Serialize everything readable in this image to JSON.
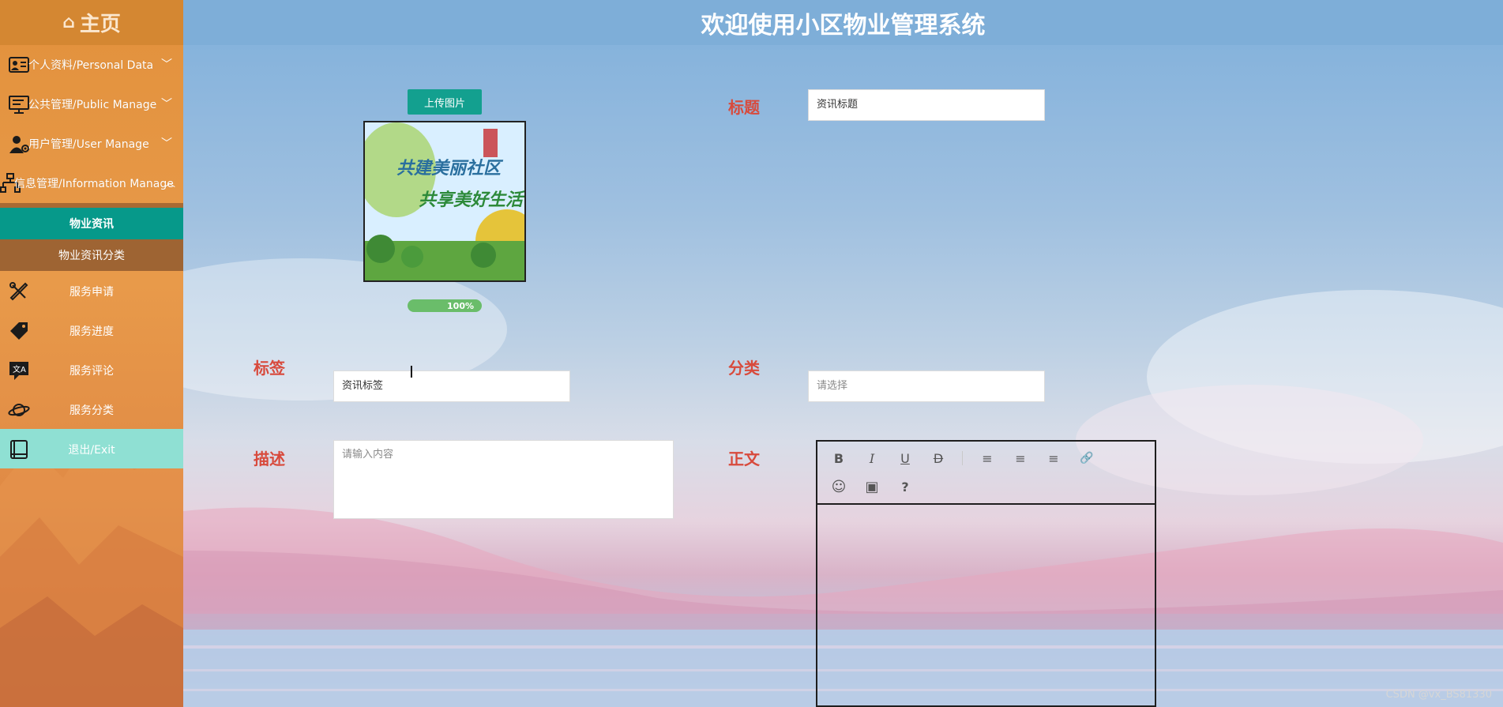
{
  "sidebar": {
    "home_label": "主页",
    "menus": [
      {
        "label": "个人资料/Personal Data",
        "icon": "user-card-icon",
        "chevron": "﹀"
      },
      {
        "label": "公共管理/Public Manage",
        "icon": "monitor-icon",
        "chevron": "﹀"
      },
      {
        "label": "用户管理/User Manage",
        "icon": "user-gear-icon",
        "chevron": "﹀"
      },
      {
        "label": "信息管理/Information Manage",
        "icon": "hierarchy-icon",
        "chevron": "︿"
      }
    ],
    "sub_items": [
      {
        "label": "物业资讯",
        "active": true
      },
      {
        "label": "物业资讯分类",
        "active": false
      }
    ],
    "items": [
      {
        "label": "服务申请",
        "icon": "tools-icon"
      },
      {
        "label": "服务进度",
        "icon": "tag-icon"
      },
      {
        "label": "服务评论",
        "icon": "translate-chat-icon"
      },
      {
        "label": "服务分类",
        "icon": "planet-icon"
      },
      {
        "label": "退出/Exit",
        "icon": "book-icon"
      }
    ]
  },
  "header": {
    "title": "欢迎使用小区物业管理系统"
  },
  "form": {
    "upload_button": "上传图片",
    "image_caption_line1": "共建美丽社区",
    "image_caption_line2": "共享美好生活",
    "progress_text": "100%",
    "progress_value": 1.0,
    "title_label": "标题",
    "title_value": "资讯标题",
    "tag_label": "标签",
    "tag_value": "资讯标签",
    "category_label": "分类",
    "category_placeholder": "请选择",
    "description_label": "描述",
    "description_placeholder": "请输入内容",
    "content_label": "正文"
  },
  "editor_toolbar": [
    {
      "name": "bold-icon",
      "glyph": "B"
    },
    {
      "name": "italic-icon",
      "glyph": "I"
    },
    {
      "name": "underline-icon",
      "glyph": "U"
    },
    {
      "name": "strikethrough-icon",
      "glyph": "D"
    },
    {
      "name": "align-left-icon",
      "glyph": "≡"
    },
    {
      "name": "align-center-icon",
      "glyph": "≡"
    },
    {
      "name": "align-right-icon",
      "glyph": "≡"
    },
    {
      "name": "link-icon",
      "glyph": "🔗"
    },
    {
      "name": "emoji-icon",
      "glyph": "☺"
    },
    {
      "name": "image-icon",
      "glyph": "▣"
    },
    {
      "name": "help-icon",
      "glyph": "?"
    }
  ],
  "watermark": "CSDN @vx_BS81330",
  "colors": {
    "sidebar_bg": "#e2913c",
    "active_sub": "#06998a",
    "label_red": "#d84a3c",
    "header_bg": "#7eaed8",
    "exit_bg": "#8fe0d3"
  }
}
